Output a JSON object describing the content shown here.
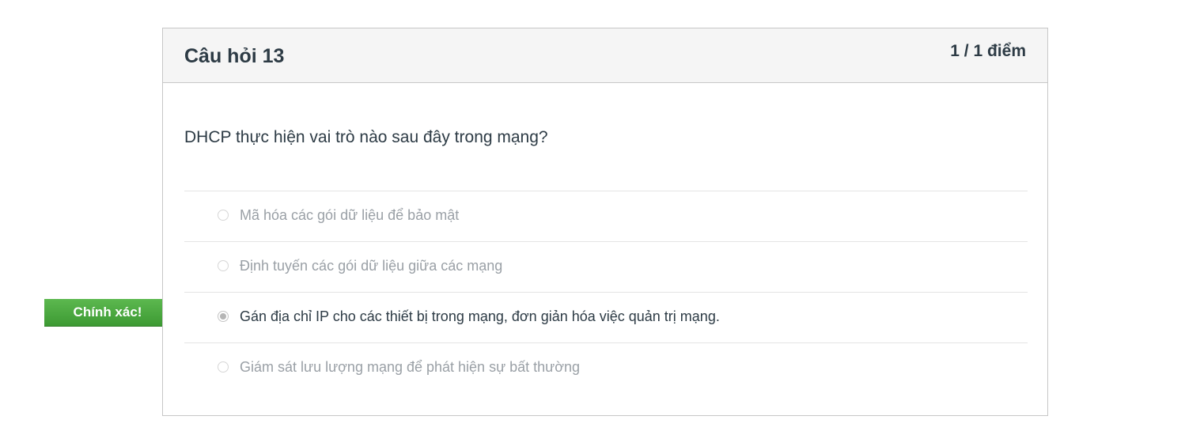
{
  "question": {
    "title": "Câu hỏi 13",
    "score": "1 / 1 điểm",
    "text": "DHCP thực hiện vai trò nào sau đây trong mạng?",
    "correct_flag_label": "Chính xác!",
    "answers": [
      {
        "label": "Mã hóa các gói dữ liệu để bảo mật",
        "selected": false
      },
      {
        "label": "Định tuyến các gói dữ liệu giữa các mạng",
        "selected": false
      },
      {
        "label": "Gán địa chỉ IP cho các thiết bị trong mạng, đơn giản hóa việc quản trị mạng.",
        "selected": true
      },
      {
        "label": "Giám sát lưu lượng mạng để phát hiện sự bất thường",
        "selected": false
      }
    ]
  },
  "colors": {
    "flag_green": "#4aa83f",
    "text_dark": "#2d3b45",
    "text_muted": "#9aa0a6"
  }
}
